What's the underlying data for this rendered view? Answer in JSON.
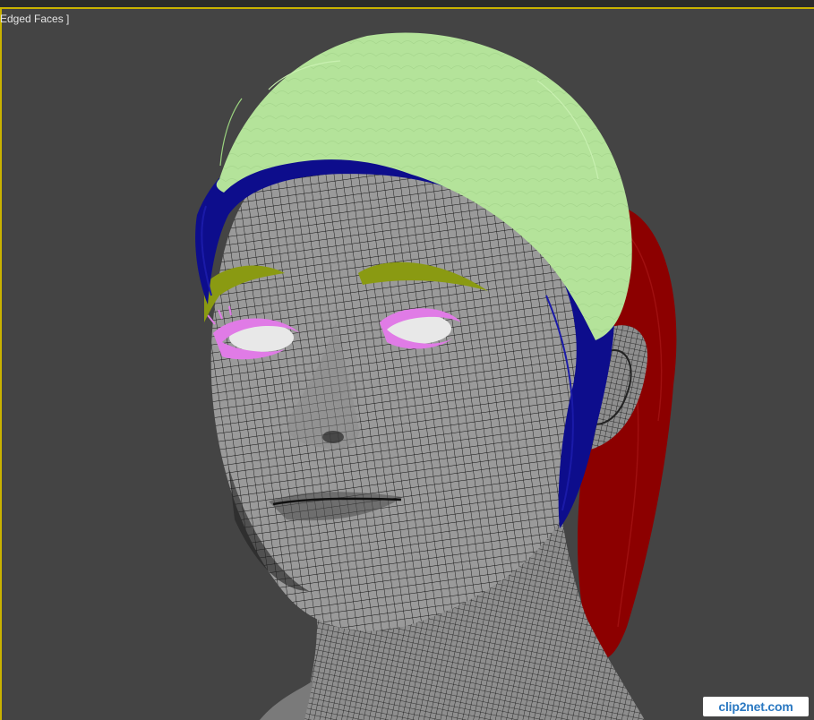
{
  "viewport": {
    "label": "Edged Faces ]",
    "background_color": "#444444",
    "active_border_color": "#c9b200"
  },
  "scene": {
    "mesh_color": "#9a9a9a",
    "wire_color": "#111111",
    "hair_main_color": "#b4e39a",
    "hair_under_color": "#0d0d8c",
    "hair_back_color": "#8c0000",
    "eyebrow_color": "#8a9a12",
    "eyelash_color": "#e07be6"
  },
  "watermark": {
    "text": "clip2net.com"
  }
}
